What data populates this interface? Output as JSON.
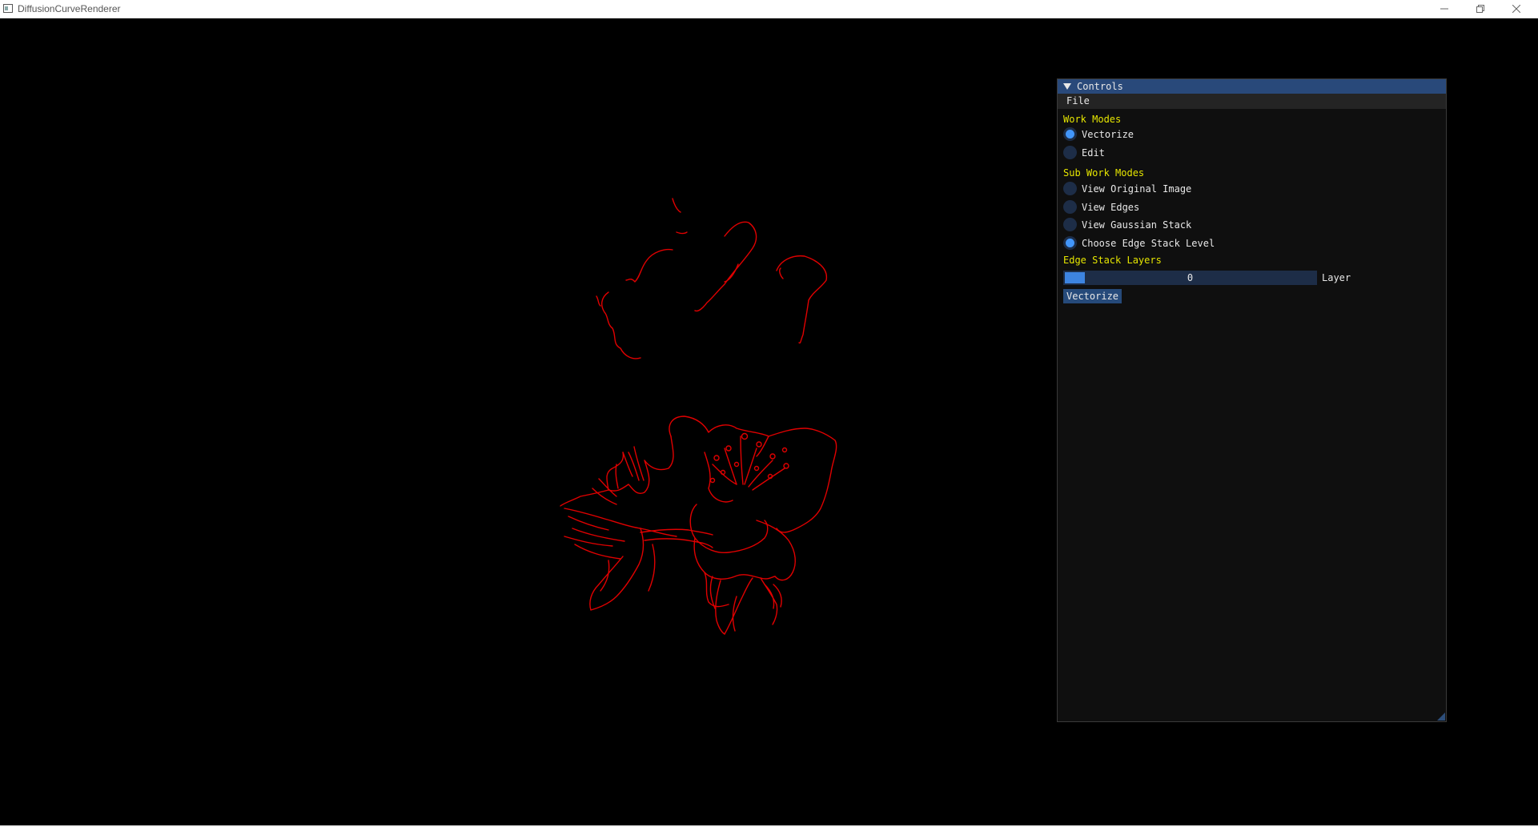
{
  "window": {
    "title": "DiffusionCurveRenderer",
    "icon": "app-window-icon",
    "buttons": [
      "minimize-icon",
      "restore-icon",
      "close-icon"
    ]
  },
  "canvas": {
    "background": "#000000",
    "stroke_color": "#ff0000",
    "content": "flower-edge-curves"
  },
  "controls": {
    "title": "Controls",
    "menu": {
      "file": "File"
    },
    "work_modes": {
      "header": "Work Modes",
      "options": [
        {
          "label": "Vectorize",
          "selected": true
        },
        {
          "label": "Edit",
          "selected": false
        }
      ]
    },
    "sub_work_modes": {
      "header": "Sub Work Modes",
      "options": [
        {
          "label": "View Original Image",
          "selected": false
        },
        {
          "label": "View Edges",
          "selected": false
        },
        {
          "label": "View Gaussian Stack",
          "selected": false
        },
        {
          "label": "Choose Edge Stack Level",
          "selected": true
        }
      ]
    },
    "edge_stack": {
      "header": "Edge Stack Layers",
      "slider_value": "0",
      "slider_label": "Layer"
    },
    "vectorize_button": "Vectorize",
    "colors": {
      "title_bg": "#29497a",
      "header_text": "#e6e600",
      "accent": "#4296fa",
      "frame_bg": "#1d2d47"
    }
  }
}
